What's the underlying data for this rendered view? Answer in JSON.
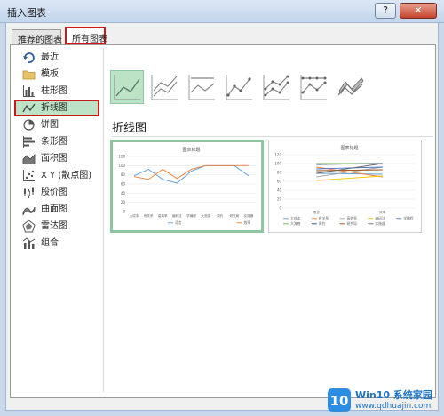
{
  "window": {
    "title": "插入图表",
    "help_label": "?",
    "close_label": "✕"
  },
  "tabs": [
    {
      "label": "推荐的图表",
      "selected": false
    },
    {
      "label": "所有图表",
      "selected": true
    }
  ],
  "sidebar": {
    "items": [
      {
        "label": "最近",
        "icon": "recent-icon"
      },
      {
        "label": "模板",
        "icon": "folder-icon"
      },
      {
        "label": "柱形图",
        "icon": "column-chart-icon"
      },
      {
        "label": "折线图",
        "icon": "line-chart-icon",
        "selected": true
      },
      {
        "label": "饼图",
        "icon": "pie-chart-icon"
      },
      {
        "label": "条形图",
        "icon": "bar-chart-icon"
      },
      {
        "label": "面积图",
        "icon": "area-chart-icon"
      },
      {
        "label": "X Y (散点图)",
        "icon": "scatter-chart-icon"
      },
      {
        "label": "股价图",
        "icon": "stock-chart-icon"
      },
      {
        "label": "曲面图",
        "icon": "surface-chart-icon"
      },
      {
        "label": "雷达图",
        "icon": "radar-chart-icon"
      },
      {
        "label": "组合",
        "icon": "combo-chart-icon"
      }
    ]
  },
  "subtypes": [
    {
      "name": "line",
      "selected": true
    },
    {
      "name": "stacked-line"
    },
    {
      "name": "100-stacked-line"
    },
    {
      "name": "line-with-markers"
    },
    {
      "name": "stacked-line-with-markers"
    },
    {
      "name": "100-stacked-line-with-markers"
    },
    {
      "name": "3d-line"
    }
  ],
  "section_title": "折线图",
  "previews": [
    {
      "title": "图表标题",
      "yticks": [
        "120",
        "100",
        "80",
        "60",
        "40",
        "20",
        "0"
      ],
      "categories": [
        "大成本",
        "有关系",
        "高效率",
        "编码法",
        "学编程",
        "大流感",
        "周约",
        "研究局",
        "实施器"
      ],
      "legend": [
        "语言",
        "效率"
      ],
      "chart_data": {
        "type": "line",
        "ylim": [
          0,
          120
        ],
        "categories": [
          "大成本",
          "有关系",
          "高效率",
          "编码法",
          "学编程",
          "大流感",
          "周约",
          "研究局",
          "实施器"
        ],
        "series": [
          {
            "name": "语言",
            "values": [
              78,
              92,
              70,
              62,
              88,
              100,
              100,
              100,
              78
            ],
            "color": "#5b9bd5"
          },
          {
            "name": "效率",
            "values": [
              76,
              70,
              92,
              72,
              92,
              100,
              100,
              100,
              100
            ],
            "color": "#ed7d31"
          }
        ]
      }
    },
    {
      "title": "图表标题",
      "yticks": [
        "120",
        "100",
        "80",
        "60",
        "40",
        "20",
        "0"
      ],
      "categories": [
        "语言",
        "效率"
      ],
      "legend": [
        "大成本",
        "有关系",
        "高效率",
        "编码法",
        "学编程",
        "大流感",
        "周约",
        "研究局",
        "实施器"
      ],
      "chart_data": {
        "type": "line",
        "ylim": [
          0,
          120
        ],
        "categories": [
          "语言",
          "效率"
        ],
        "series": [
          {
            "name": "大成本",
            "values": [
              78,
              76
            ],
            "color": "#5b9bd5"
          },
          {
            "name": "有关系",
            "values": [
              92,
              70
            ],
            "color": "#ed7d31"
          },
          {
            "name": "高效率",
            "values": [
              70,
              92
            ],
            "color": "#a5a5a5"
          },
          {
            "name": "编码法",
            "values": [
              62,
              72
            ],
            "color": "#ffc000"
          },
          {
            "name": "学编程",
            "values": [
              88,
              92
            ],
            "color": "#4472c4"
          },
          {
            "name": "大流感",
            "values": [
              100,
              100
            ],
            "color": "#70ad47"
          },
          {
            "name": "周约",
            "values": [
              98,
              100
            ],
            "color": "#264478"
          },
          {
            "name": "研究局",
            "values": [
              84,
              86
            ],
            "color": "#9e480e"
          },
          {
            "name": "实施器",
            "values": [
              78,
              100
            ],
            "color": "#636363"
          }
        ]
      }
    }
  ],
  "watermark": {
    "brand": "Win10 系统家园",
    "url": "www.qdhuajin.com",
    "logo_text": "10"
  }
}
